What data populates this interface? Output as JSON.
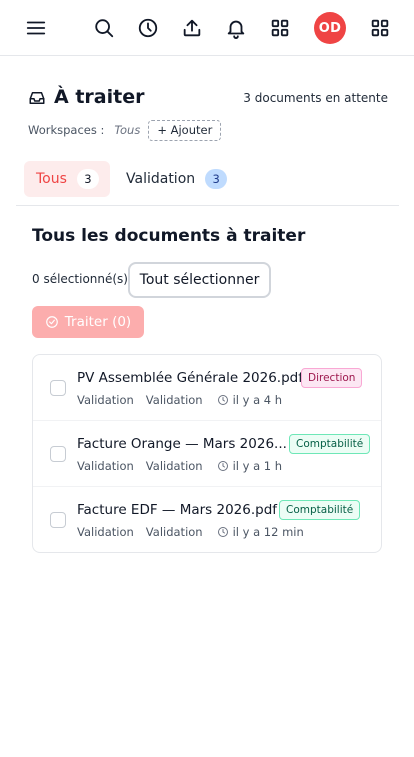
{
  "topbar": {
    "icons": [
      "menu-icon",
      "search-icon",
      "history-icon",
      "upload-icon",
      "bell-icon",
      "apps-grid-icon",
      "apps-grid-icon"
    ],
    "avatar_initials": "OD",
    "avatar_color": "#ef4444"
  },
  "header": {
    "icon": "inbox-icon",
    "title": "À traiter",
    "pending": "3 documents en attente"
  },
  "workspaces": {
    "label": "Workspaces :",
    "value": "Tous",
    "add_label": "+ Ajouter"
  },
  "tabs": [
    {
      "label": "Tous",
      "count": "3",
      "active": true
    },
    {
      "label": "Validation",
      "count": "3",
      "active": false
    }
  ],
  "section": {
    "title": "Tous les documents à traiter"
  },
  "selection": {
    "count_text": "0 sélectionné(s)",
    "select_all_label": "Tout sélectionner",
    "process_label": "Traiter (0)"
  },
  "documents": [
    {
      "name": "PV Assemblée Générale 2026.pdf",
      "tag": "Direction",
      "meta1": "Validation",
      "meta2": "Validation",
      "time": "il y a 4 h"
    },
    {
      "name": "Facture Orange — Mars 2026...",
      "tag": "Comptabilité",
      "meta1": "Validation",
      "meta2": "Validation",
      "time": "il y a 1 h"
    },
    {
      "name": "Facture EDF — Mars 2026.pdf",
      "tag": "Comptabilité",
      "meta1": "Validation",
      "meta2": "Validation",
      "time": "il y a 12 min"
    }
  ],
  "colors": {
    "accent": "#ef4444",
    "tab_active_bg": "#fdecec",
    "process_btn": "#fca5a5",
    "badge_blue": "#bfdbfe"
  }
}
